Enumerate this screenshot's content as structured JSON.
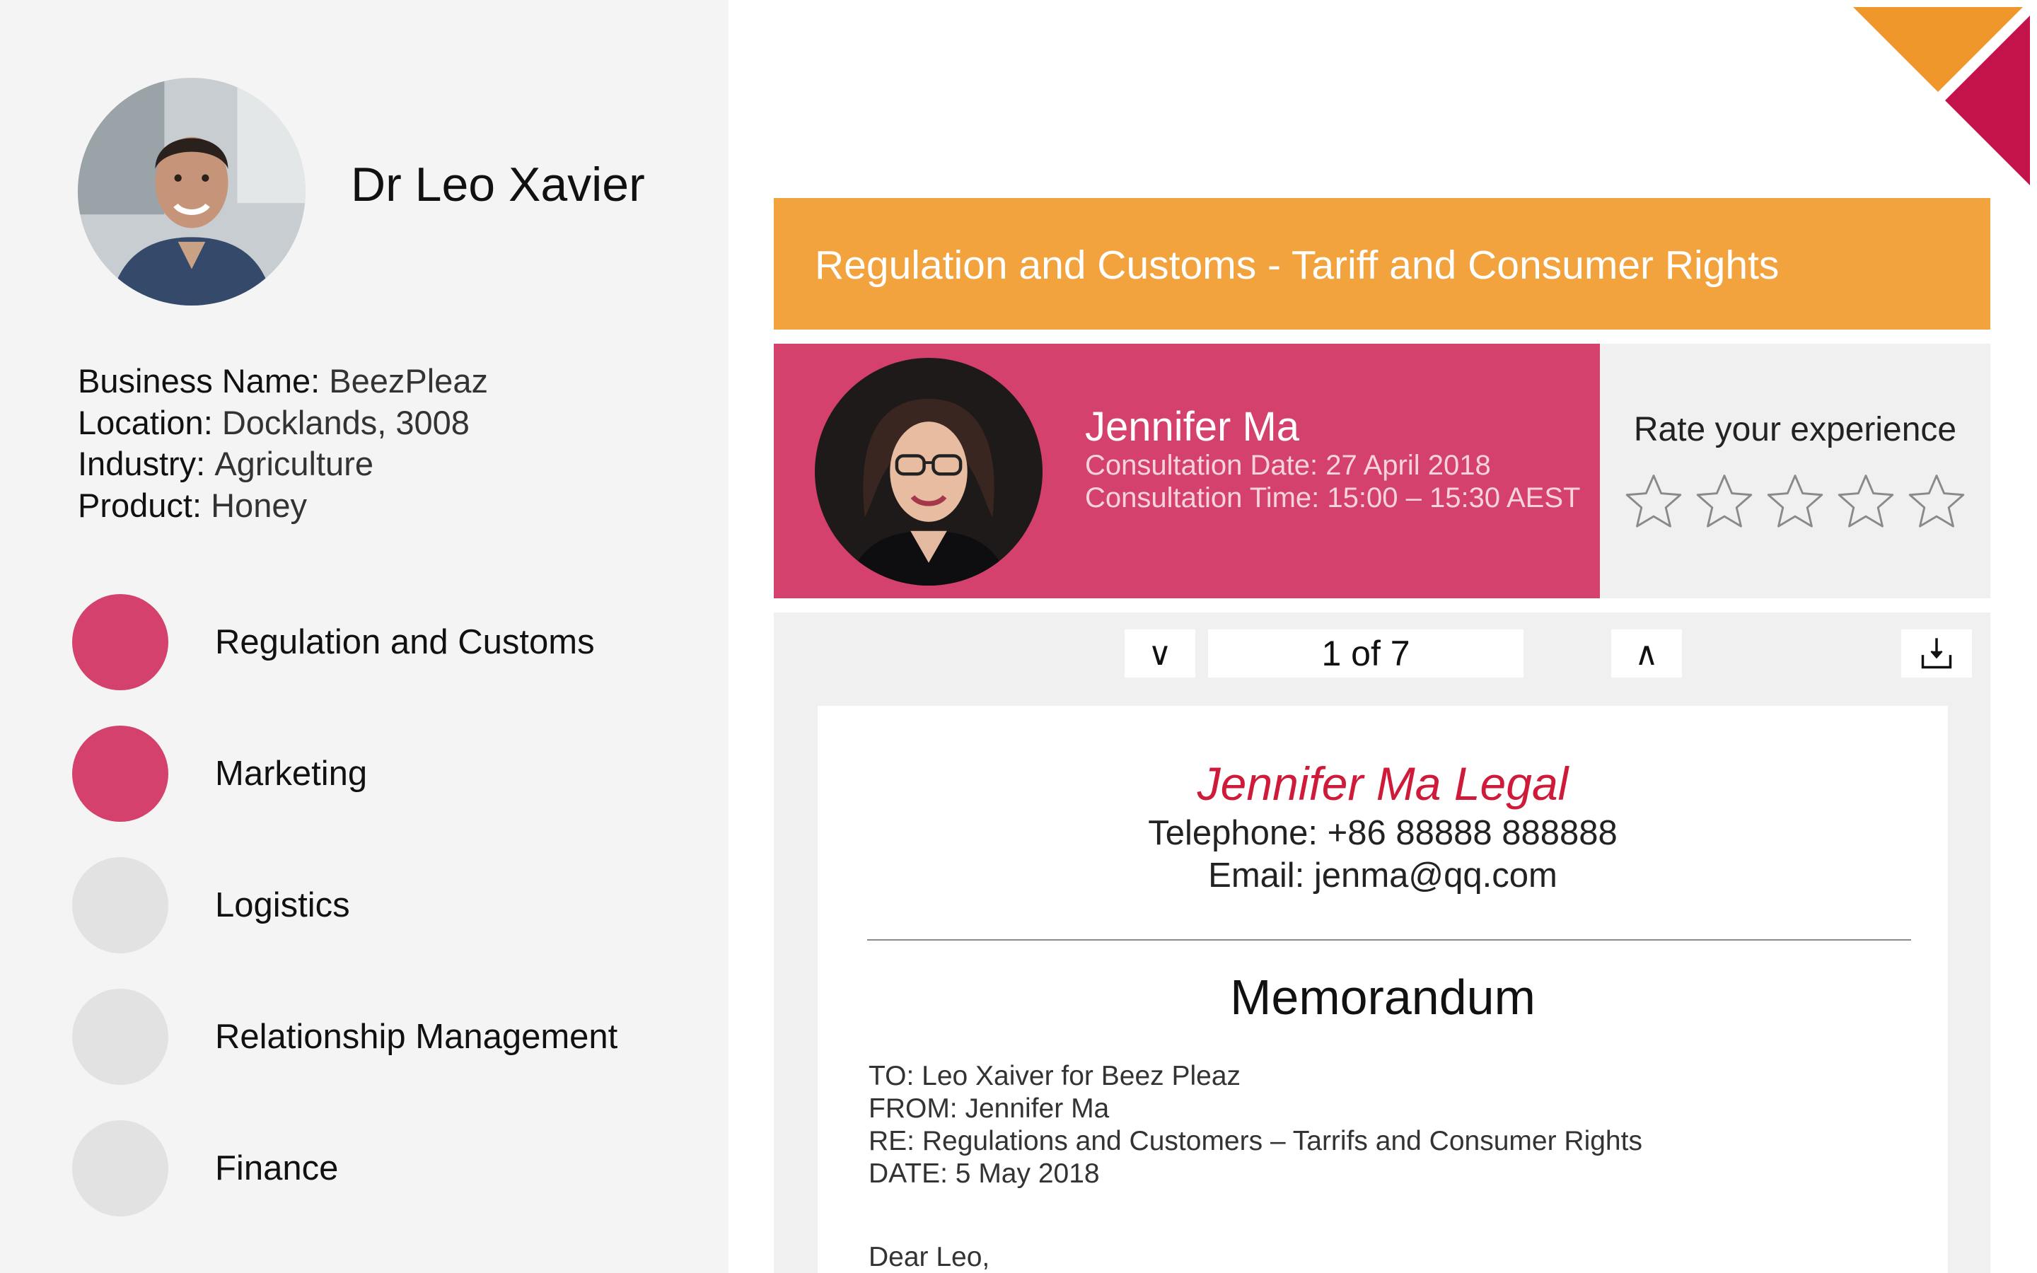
{
  "profile": {
    "name": "Dr Leo Xavier",
    "info": [
      {
        "label": "Business Name:",
        "value": "BeezPleaz"
      },
      {
        "label": "Location:",
        "value": "Docklands, 3008"
      },
      {
        "label": "Industry:",
        "value": "Agriculture"
      },
      {
        "label": "Product:",
        "value": "Honey"
      }
    ]
  },
  "topics": [
    {
      "label": "Regulation and Customs",
      "active": true
    },
    {
      "label": "Marketing",
      "active": true
    },
    {
      "label": "Logistics",
      "active": false
    },
    {
      "label": "Relationship Management",
      "active": false
    },
    {
      "label": "Finance",
      "active": false
    }
  ],
  "banner": {
    "title": "Regulation and Customs - Tariff and Consumer Rights"
  },
  "consultant": {
    "name": "Jennifer Ma",
    "date": "Consultation Date: 27 April 2018",
    "time": "Consultation Time: 15:00 – 15:30 AEST"
  },
  "rating": {
    "title": "Rate your experience",
    "max": 5,
    "value": 0
  },
  "viewer": {
    "prev_label": "∨",
    "page_indicator": "1 of 7",
    "next_label": "∧"
  },
  "document": {
    "firm": "Jennifer Ma Legal",
    "telephone": "Telephone: +86 88888 888888",
    "email": "Email: jenma@qq.com",
    "heading": "Memorandum",
    "memo": {
      "to": "TO: Leo Xaiver for Beez Pleaz",
      "from": "FROM: Jennifer Ma",
      "re": "RE: Regulations and Customers – Tarrifs and Consumer Rights",
      "date": "DATE: 5 May 2018"
    },
    "salutation": "Dear Leo,"
  },
  "colors": {
    "accent_pink": "#d3416c",
    "banner_orange": "#f2a33e",
    "corner_orange": "#f0972c",
    "corner_crimson": "#c4134a",
    "firm_red": "#cf1b3a"
  }
}
